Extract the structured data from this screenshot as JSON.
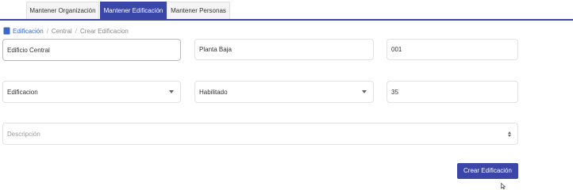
{
  "tabs": [
    {
      "label": "Mantener Organización"
    },
    {
      "label": "Mantener Edificación",
      "active": true
    },
    {
      "label": "Mantener Personas"
    }
  ],
  "breadcrumb": {
    "root": "Edificación",
    "items": [
      "Central",
      "Crear Edificacion"
    ]
  },
  "form": {
    "nombre": "Edificio Central",
    "planta": "Planta Baja",
    "codigo": "001",
    "tipo": "Edificacion",
    "estado": "Habilitado",
    "cantidad": "35",
    "descripcion_placeholder": "Descripción"
  },
  "actions": {
    "crear_label": "Crear Edificación"
  },
  "colors": {
    "accent": "#3a47a8",
    "link": "#3a67c8"
  }
}
